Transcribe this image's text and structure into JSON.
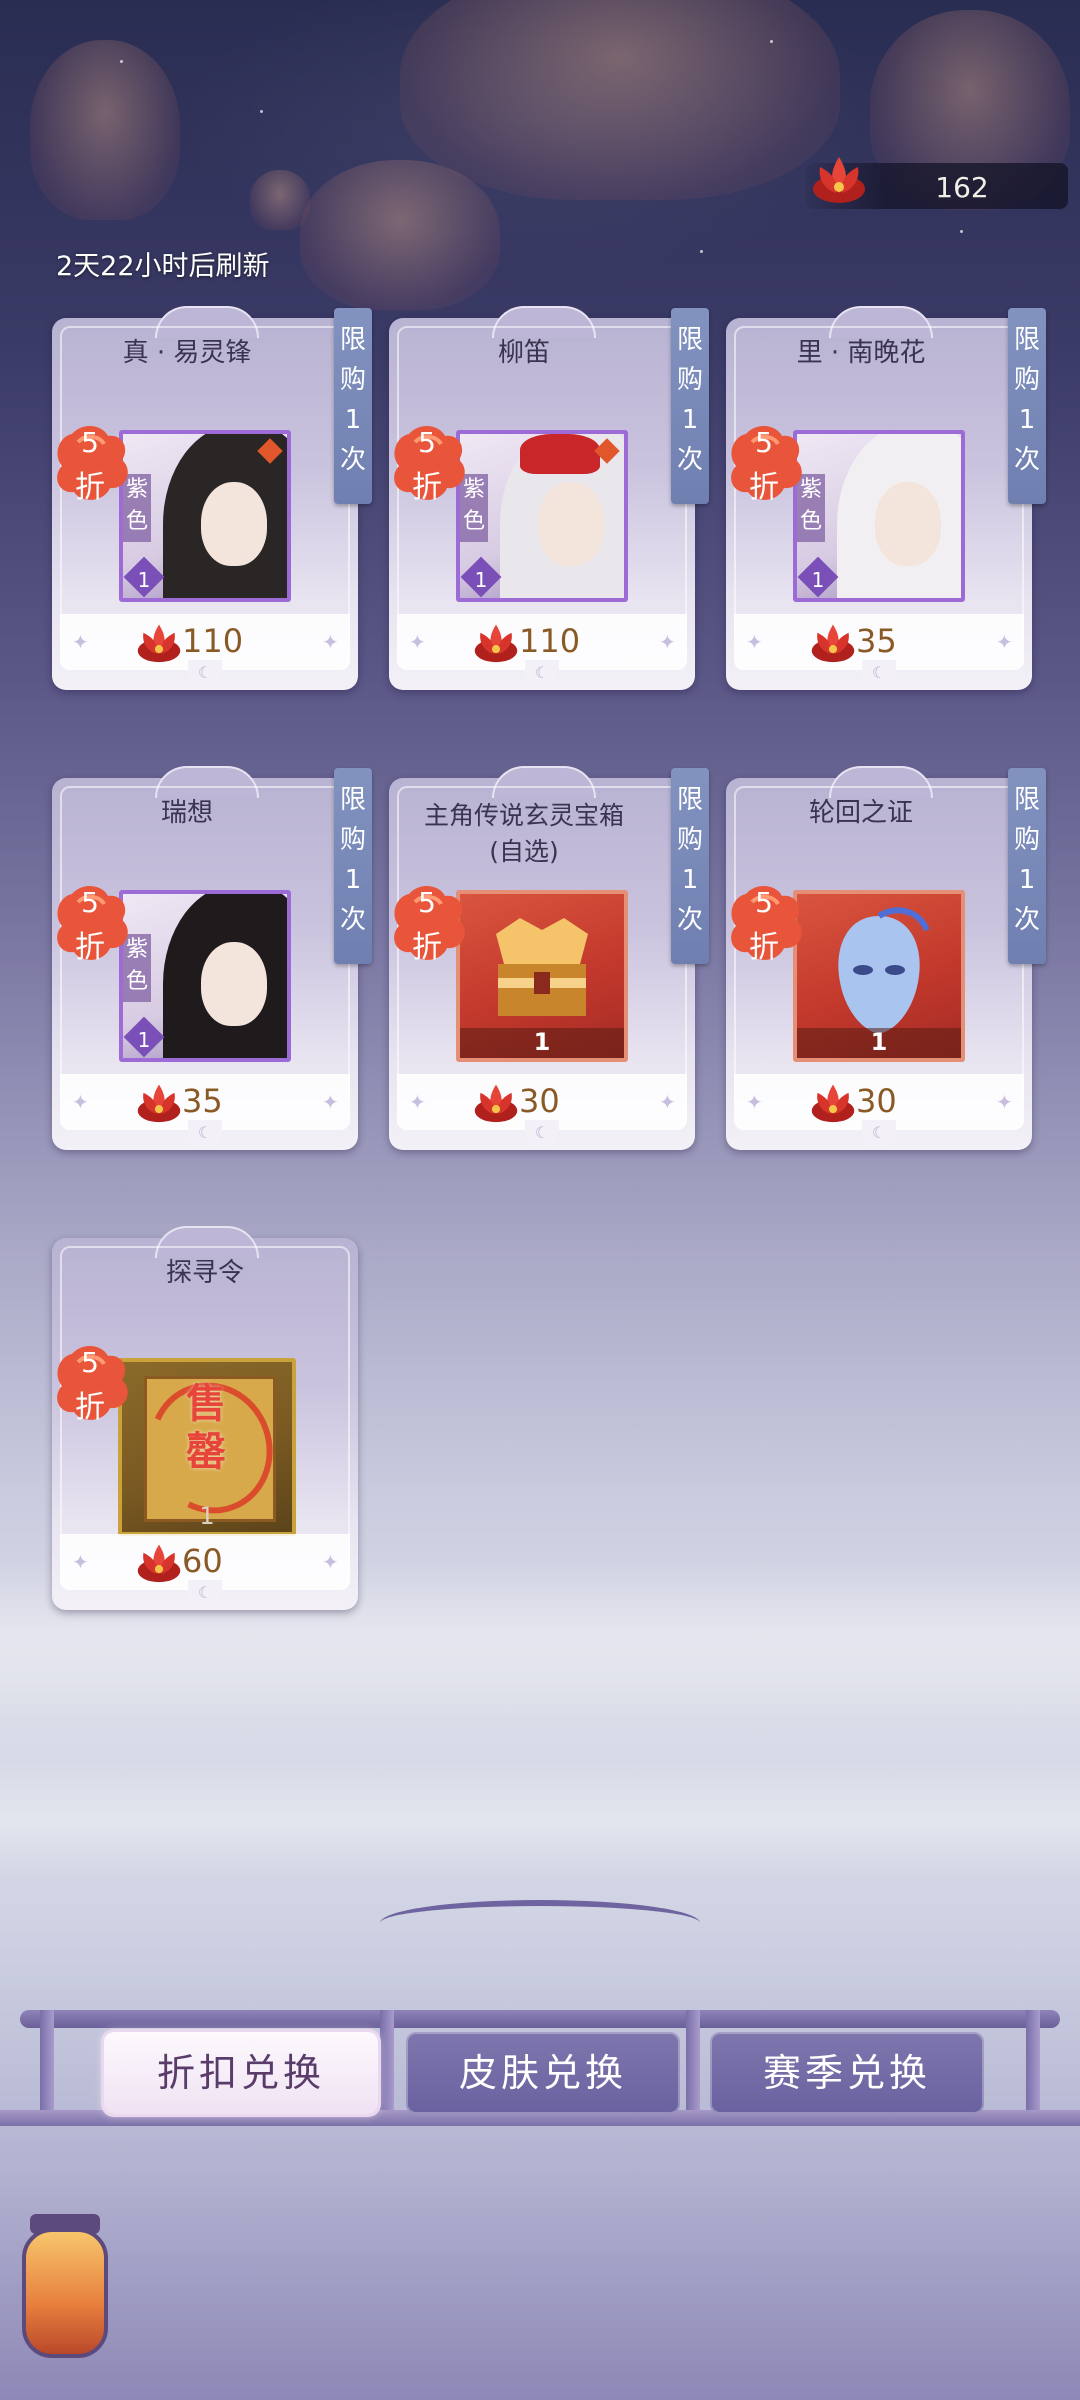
{
  "currency": {
    "icon": "red-lotus-icon",
    "value": "162"
  },
  "refresh_text": "2天22小时后刷新",
  "cards": [
    {
      "title": "真 · 易灵锋",
      "limit": "限\n购\n1\n次",
      "discount_num": "5",
      "discount_text": "折",
      "grade": "紫\n色",
      "rank": "1",
      "price": "110",
      "item_type": "portrait"
    },
    {
      "title": "柳笛",
      "limit": "限\n购\n1\n次",
      "discount_num": "5",
      "discount_text": "折",
      "grade": "紫\n色",
      "rank": "1",
      "price": "110",
      "item_type": "portrait"
    },
    {
      "title": "里 · 南晚花",
      "limit": "限\n购\n1\n次",
      "discount_num": "5",
      "discount_text": "折",
      "grade": "紫\n色",
      "rank": "1",
      "price": "35",
      "item_type": "portrait"
    },
    {
      "title": "瑞想",
      "limit": "限\n购\n1\n次",
      "discount_num": "5",
      "discount_text": "折",
      "grade": "紫\n色",
      "rank": "1",
      "price": "35",
      "item_type": "portrait"
    },
    {
      "title": "主角传说玄灵宝箱(自选)",
      "limit": "限\n购\n1\n次",
      "discount_num": "5",
      "discount_text": "折",
      "quantity": "1",
      "price": "30",
      "item_type": "chest"
    },
    {
      "title": "轮回之证",
      "limit": "限\n购\n1\n次",
      "discount_num": "5",
      "discount_text": "折",
      "quantity": "1",
      "price": "30",
      "item_type": "mask"
    },
    {
      "title": "探寻令",
      "discount_num": "5",
      "discount_text": "折",
      "quantity": "1",
      "price": "60",
      "item_type": "token",
      "sold_out": "售\n罄"
    }
  ],
  "tabs": [
    {
      "label": "折扣兑换",
      "active": true
    },
    {
      "label": "皮肤兑换",
      "active": false
    },
    {
      "label": "赛季兑换",
      "active": false
    }
  ],
  "colors": {
    "limit_tag": "#7686b6",
    "price_text": "#8a5a26",
    "discount_badge": "#e8553a",
    "tab_active_text": "#5a3c6a"
  }
}
